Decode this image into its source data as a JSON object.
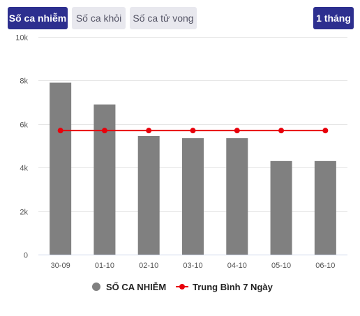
{
  "toolbar": {
    "tabs": [
      {
        "label": "Số ca nhiễm",
        "active": true
      },
      {
        "label": "Số ca khỏi",
        "active": false
      },
      {
        "label": "Số ca tử vong",
        "active": false
      }
    ],
    "period_label": "1 tháng"
  },
  "chart_data": {
    "type": "bar",
    "categories": [
      "30-09",
      "01-10",
      "02-10",
      "03-10",
      "04-10",
      "05-10",
      "06-10"
    ],
    "series": [
      {
        "name": "SỐ CA NHIỄM",
        "type": "bar",
        "color": "#808080",
        "values": [
          7900,
          6900,
          5450,
          5350,
          5350,
          4300,
          4300
        ]
      },
      {
        "name": "Trung Bình 7 Ngày",
        "type": "line",
        "color": "#e8000b",
        "values": [
          5700,
          5700,
          5700,
          5700,
          5700,
          5700,
          5700
        ]
      }
    ],
    "ylim": [
      0,
      10000
    ],
    "yticks": [
      0,
      2000,
      4000,
      6000,
      8000,
      10000
    ],
    "ytick_labels": [
      "0",
      "2k",
      "4k",
      "6k",
      "8k",
      "10k"
    ],
    "grid": true,
    "legend_position": "bottom-center"
  }
}
